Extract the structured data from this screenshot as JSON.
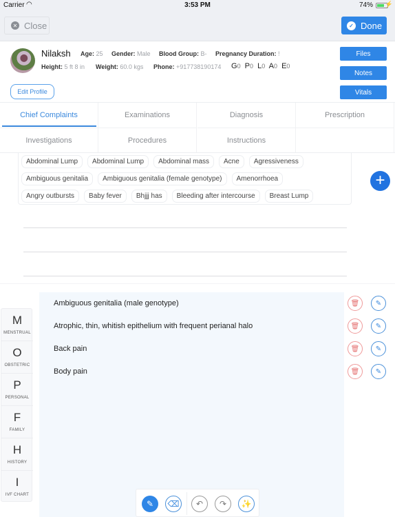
{
  "status_bar": {
    "carrier": "Carrier",
    "time": "3:53 PM",
    "battery_percent": "74%",
    "battery_level": 0.74
  },
  "nav": {
    "close_label": "Close",
    "done_label": "Done"
  },
  "patient": {
    "name": "Nilaksh",
    "age_label": "Age:",
    "age": "25",
    "gender_label": "Gender:",
    "gender": "Male",
    "blood_group_label": "Blood Group:",
    "blood_group": "B-",
    "pregnancy_label": "Pregnancy Duration:",
    "pregnancy": "!",
    "height_label": "Height:",
    "height": "5 ft 8 in",
    "weight_label": "Weight:",
    "weight": "60.0 kgs",
    "phone_label": "Phone:",
    "phone": "+917738190174",
    "gplae": [
      {
        "letter": "G",
        "value": "0"
      },
      {
        "letter": "P",
        "value": "0"
      },
      {
        "letter": "L",
        "value": "0"
      },
      {
        "letter": "A",
        "value": "0"
      },
      {
        "letter": "E",
        "value": "0"
      }
    ],
    "edit_profile_label": "Edit Profile"
  },
  "side_buttons": {
    "files": "Files",
    "notes": "Notes",
    "vitals": "Vitals"
  },
  "tabs": [
    {
      "label": "Chief Complaints",
      "active": true
    },
    {
      "label": "Examinations",
      "active": false
    },
    {
      "label": "Diagnosis",
      "active": false
    },
    {
      "label": "Prescription",
      "active": false
    },
    {
      "label": "Investigations",
      "active": false
    },
    {
      "label": "Procedures",
      "active": false
    },
    {
      "label": "Instructions",
      "active": false
    }
  ],
  "suggestion_chips": [
    [
      "Abdominal Lump",
      "Abdominal Lump",
      "Abdominal mass",
      "Acne",
      "Agressiveness"
    ],
    [
      "Ambiguous genitalia",
      "Ambiguous genitalia (female genotype)",
      "Amenorrhoea"
    ],
    [
      "Angry outbursts",
      "Baby fever",
      "Bhjjj has",
      "Bleeding after intercourse",
      "Breast Lump"
    ]
  ],
  "complaints": [
    "Ambiguous genitalia (male genotype)",
    "Atrophic, thin, whitish epithelium with frequent perianal halo",
    "Back pain",
    "Body pain"
  ],
  "history_nav": [
    {
      "letter": "M",
      "label": "MENSTRUAL"
    },
    {
      "letter": "O",
      "label": "OBSTETRIC"
    },
    {
      "letter": "P",
      "label": "PERSONAL"
    },
    {
      "letter": "F",
      "label": "FAMILY"
    },
    {
      "letter": "H",
      "label": "HISTORY"
    },
    {
      "letter": "I",
      "label": "IVF CHART"
    }
  ],
  "drawing_tools": {
    "pencil": "pencil-icon",
    "eraser": "eraser-icon",
    "undo": "undo-icon",
    "redo": "redo-icon",
    "clear": "clear-brush-icon"
  },
  "colors": {
    "accent": "#2f86e6",
    "delete": "#e57373",
    "panel_bg": "#f3f8fd"
  }
}
